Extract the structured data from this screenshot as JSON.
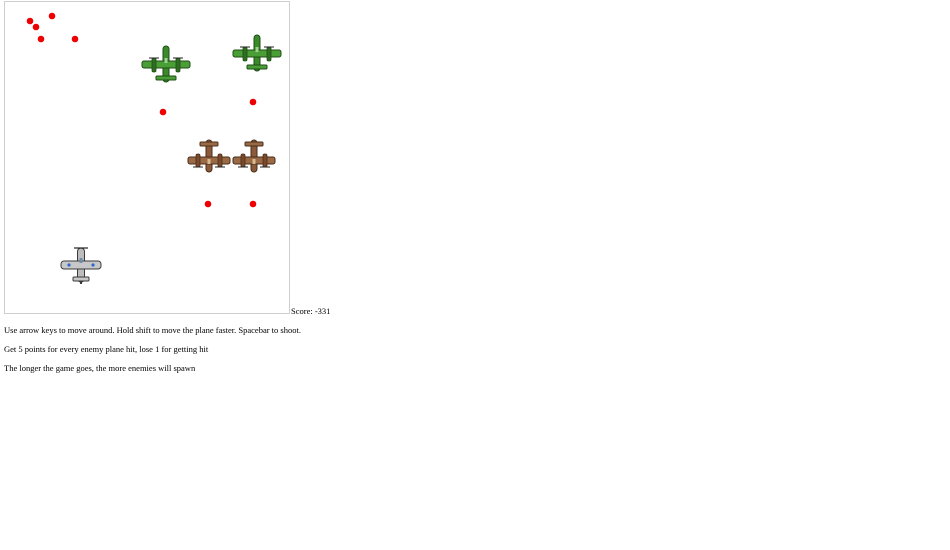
{
  "game": {
    "score_label": "Score:",
    "score_value": "-331",
    "instructions": [
      "Use arrow keys to move around. Hold shift to move the plane faster. Spacebar to shoot.",
      "Get 5 points for every enemy plane hit, lose 1 for getting hit",
      "The longer the game goes, the more enemies will spawn"
    ],
    "sprites": {
      "player_plane": "silver-fighter-plane",
      "green_enemy": "green-bomber-plane",
      "brown_enemy": "brown-fighter-plane",
      "bullet": "red-bullet"
    },
    "colors": {
      "bullet": "#ee0000",
      "green_plane": "#3a8a2a",
      "brown_plane": "#8a5a3a",
      "player_plane": "#b8b8b8"
    }
  }
}
